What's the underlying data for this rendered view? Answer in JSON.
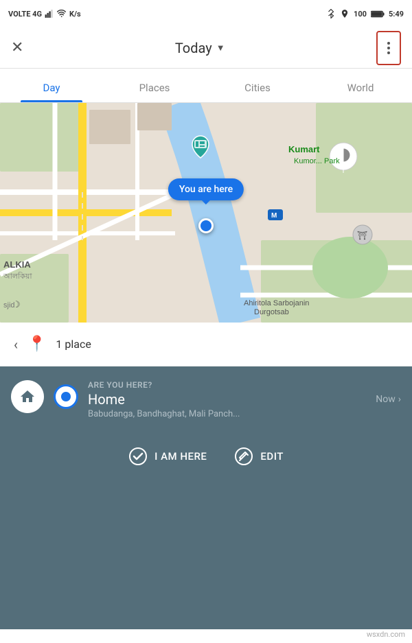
{
  "statusBar": {
    "left": "VOLTE 4G",
    "network": "K/s",
    "time": "5:49",
    "battery": "100"
  },
  "header": {
    "closeLabel": "✕",
    "title": "Today",
    "titleArrow": "▼",
    "moreLabel": "⋮"
  },
  "tabs": [
    {
      "id": "day",
      "label": "Day",
      "active": true
    },
    {
      "id": "places",
      "label": "Places",
      "active": false
    },
    {
      "id": "cities",
      "label": "Cities",
      "active": false
    },
    {
      "id": "world",
      "label": "World",
      "active": false
    }
  ],
  "map": {
    "youAreHereLabel": "You are here"
  },
  "placesBar": {
    "backArrow": "‹",
    "pinIcon": "📍",
    "placesCount": "1 place"
  },
  "bottomPanel": {
    "areYouHere": "ARE YOU HERE?",
    "locationLabel": "Home",
    "timeLabel": "Now",
    "chevron": "›",
    "address": "Babudanga, Bandhaghat, Mali Panch...",
    "buttons": [
      {
        "id": "i-am-here",
        "label": "I AM HERE"
      },
      {
        "id": "edit",
        "label": "EDIT"
      }
    ]
  },
  "watermark": "wsxdn.com"
}
